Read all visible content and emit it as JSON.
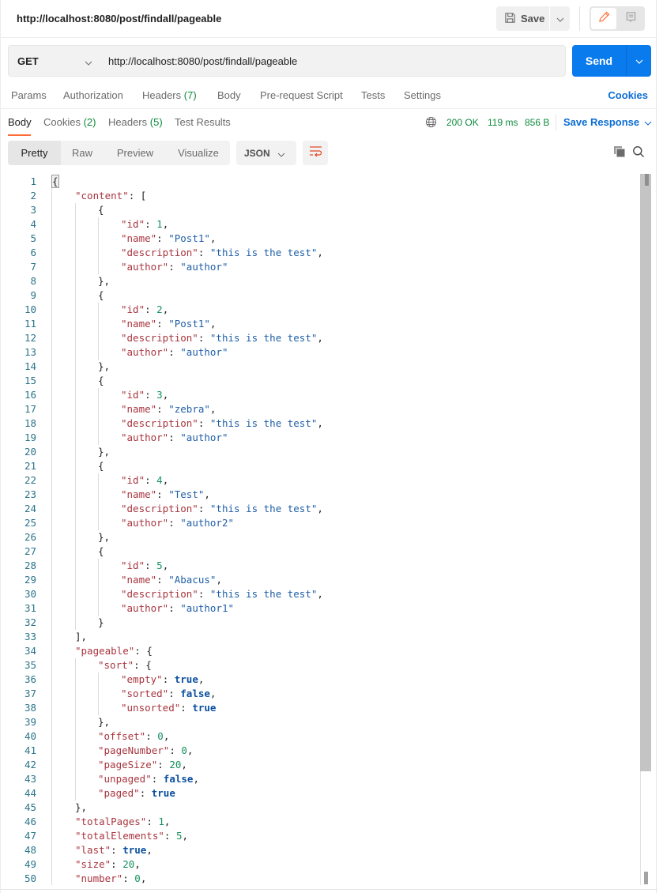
{
  "header": {
    "title": "http://localhost:8080/post/findall/pageable",
    "save_label": "Save"
  },
  "request": {
    "method": "GET",
    "url": "http://localhost:8080/post/findall/pageable",
    "send_label": "Send"
  },
  "request_tabs": {
    "params": "Params",
    "authorization": "Authorization",
    "headers": "Headers",
    "headers_count": "(7)",
    "body": "Body",
    "pre_request": "Pre-request Script",
    "tests": "Tests",
    "settings": "Settings",
    "cookies_link": "Cookies"
  },
  "response_tabs": {
    "body": "Body",
    "cookies": "Cookies",
    "cookies_count": "(2)",
    "headers": "Headers",
    "headers_count": "(5)",
    "test_results": "Test Results"
  },
  "response_status": {
    "status": "200 OK",
    "time": "119 ms",
    "size": "856 B",
    "save_response_label": "Save Response"
  },
  "view_modes": {
    "pretty": "Pretty",
    "raw": "Raw",
    "preview": "Preview",
    "visualize": "Visualize",
    "selected": "Pretty",
    "format": "JSON"
  },
  "colors": {
    "accent_orange": "#ff6c37",
    "send_blue": "#097bed",
    "link_blue": "#0b6cd4",
    "status_green": "#0e8a3c",
    "json_key": "#a8353f",
    "json_string": "#1f5fa8",
    "json_number": "#14925c",
    "json_boolean": "#0b4fa0"
  },
  "editor": {
    "lines": [
      {
        "n": "1",
        "indent": 0,
        "tokens": [
          [
            "p",
            "{"
          ]
        ],
        "cursor": true
      },
      {
        "n": "2",
        "indent": 1,
        "tokens": [
          [
            "k",
            "\"content\""
          ],
          [
            "p",
            ": ["
          ]
        ]
      },
      {
        "n": "3",
        "indent": 2,
        "tokens": [
          [
            "p",
            "{"
          ]
        ]
      },
      {
        "n": "4",
        "indent": 3,
        "tokens": [
          [
            "k",
            "\"id\""
          ],
          [
            "p",
            ": "
          ],
          [
            "n",
            "1"
          ],
          [
            "p",
            ","
          ]
        ]
      },
      {
        "n": "5",
        "indent": 3,
        "tokens": [
          [
            "k",
            "\"name\""
          ],
          [
            "p",
            ": "
          ],
          [
            "s",
            "\"Post1\""
          ],
          [
            "p",
            ","
          ]
        ]
      },
      {
        "n": "6",
        "indent": 3,
        "tokens": [
          [
            "k",
            "\"description\""
          ],
          [
            "p",
            ": "
          ],
          [
            "s",
            "\"this is the test\""
          ],
          [
            "p",
            ","
          ]
        ]
      },
      {
        "n": "7",
        "indent": 3,
        "tokens": [
          [
            "k",
            "\"author\""
          ],
          [
            "p",
            ": "
          ],
          [
            "s",
            "\"author\""
          ]
        ]
      },
      {
        "n": "8",
        "indent": 2,
        "tokens": [
          [
            "p",
            "},"
          ]
        ]
      },
      {
        "n": "9",
        "indent": 2,
        "tokens": [
          [
            "p",
            "{"
          ]
        ]
      },
      {
        "n": "10",
        "indent": 3,
        "tokens": [
          [
            "k",
            "\"id\""
          ],
          [
            "p",
            ": "
          ],
          [
            "n",
            "2"
          ],
          [
            "p",
            ","
          ]
        ]
      },
      {
        "n": "11",
        "indent": 3,
        "tokens": [
          [
            "k",
            "\"name\""
          ],
          [
            "p",
            ": "
          ],
          [
            "s",
            "\"Post1\""
          ],
          [
            "p",
            ","
          ]
        ]
      },
      {
        "n": "12",
        "indent": 3,
        "tokens": [
          [
            "k",
            "\"description\""
          ],
          [
            "p",
            ": "
          ],
          [
            "s",
            "\"this is the test\""
          ],
          [
            "p",
            ","
          ]
        ]
      },
      {
        "n": "13",
        "indent": 3,
        "tokens": [
          [
            "k",
            "\"author\""
          ],
          [
            "p",
            ": "
          ],
          [
            "s",
            "\"author\""
          ]
        ]
      },
      {
        "n": "14",
        "indent": 2,
        "tokens": [
          [
            "p",
            "},"
          ]
        ]
      },
      {
        "n": "15",
        "indent": 2,
        "tokens": [
          [
            "p",
            "{"
          ]
        ]
      },
      {
        "n": "16",
        "indent": 3,
        "tokens": [
          [
            "k",
            "\"id\""
          ],
          [
            "p",
            ": "
          ],
          [
            "n",
            "3"
          ],
          [
            "p",
            ","
          ]
        ]
      },
      {
        "n": "17",
        "indent": 3,
        "tokens": [
          [
            "k",
            "\"name\""
          ],
          [
            "p",
            ": "
          ],
          [
            "s",
            "\"zebra\""
          ],
          [
            "p",
            ","
          ]
        ]
      },
      {
        "n": "18",
        "indent": 3,
        "tokens": [
          [
            "k",
            "\"description\""
          ],
          [
            "p",
            ": "
          ],
          [
            "s",
            "\"this is the test\""
          ],
          [
            "p",
            ","
          ]
        ]
      },
      {
        "n": "19",
        "indent": 3,
        "tokens": [
          [
            "k",
            "\"author\""
          ],
          [
            "p",
            ": "
          ],
          [
            "s",
            "\"author\""
          ]
        ]
      },
      {
        "n": "20",
        "indent": 2,
        "tokens": [
          [
            "p",
            "},"
          ]
        ]
      },
      {
        "n": "21",
        "indent": 2,
        "tokens": [
          [
            "p",
            "{"
          ]
        ]
      },
      {
        "n": "22",
        "indent": 3,
        "tokens": [
          [
            "k",
            "\"id\""
          ],
          [
            "p",
            ": "
          ],
          [
            "n",
            "4"
          ],
          [
            "p",
            ","
          ]
        ]
      },
      {
        "n": "23",
        "indent": 3,
        "tokens": [
          [
            "k",
            "\"name\""
          ],
          [
            "p",
            ": "
          ],
          [
            "s",
            "\"Test\""
          ],
          [
            "p",
            ","
          ]
        ]
      },
      {
        "n": "24",
        "indent": 3,
        "tokens": [
          [
            "k",
            "\"description\""
          ],
          [
            "p",
            ": "
          ],
          [
            "s",
            "\"this is the test\""
          ],
          [
            "p",
            ","
          ]
        ]
      },
      {
        "n": "25",
        "indent": 3,
        "tokens": [
          [
            "k",
            "\"author\""
          ],
          [
            "p",
            ": "
          ],
          [
            "s",
            "\"author2\""
          ]
        ]
      },
      {
        "n": "26",
        "indent": 2,
        "tokens": [
          [
            "p",
            "},"
          ]
        ]
      },
      {
        "n": "27",
        "indent": 2,
        "tokens": [
          [
            "p",
            "{"
          ]
        ]
      },
      {
        "n": "28",
        "indent": 3,
        "tokens": [
          [
            "k",
            "\"id\""
          ],
          [
            "p",
            ": "
          ],
          [
            "n",
            "5"
          ],
          [
            "p",
            ","
          ]
        ]
      },
      {
        "n": "29",
        "indent": 3,
        "tokens": [
          [
            "k",
            "\"name\""
          ],
          [
            "p",
            ": "
          ],
          [
            "s",
            "\"Abacus\""
          ],
          [
            "p",
            ","
          ]
        ]
      },
      {
        "n": "30",
        "indent": 3,
        "tokens": [
          [
            "k",
            "\"description\""
          ],
          [
            "p",
            ": "
          ],
          [
            "s",
            "\"this is the test\""
          ],
          [
            "p",
            ","
          ]
        ]
      },
      {
        "n": "31",
        "indent": 3,
        "tokens": [
          [
            "k",
            "\"author\""
          ],
          [
            "p",
            ": "
          ],
          [
            "s",
            "\"author1\""
          ]
        ]
      },
      {
        "n": "32",
        "indent": 2,
        "tokens": [
          [
            "p",
            "}"
          ]
        ]
      },
      {
        "n": "33",
        "indent": 1,
        "tokens": [
          [
            "p",
            "],"
          ]
        ]
      },
      {
        "n": "34",
        "indent": 1,
        "tokens": [
          [
            "k",
            "\"pageable\""
          ],
          [
            "p",
            ": {"
          ]
        ]
      },
      {
        "n": "35",
        "indent": 2,
        "tokens": [
          [
            "k",
            "\"sort\""
          ],
          [
            "p",
            ": {"
          ]
        ]
      },
      {
        "n": "36",
        "indent": 3,
        "tokens": [
          [
            "k",
            "\"empty\""
          ],
          [
            "p",
            ": "
          ],
          [
            "b",
            "true"
          ],
          [
            "p",
            ","
          ]
        ]
      },
      {
        "n": "37",
        "indent": 3,
        "tokens": [
          [
            "k",
            "\"sorted\""
          ],
          [
            "p",
            ": "
          ],
          [
            "b",
            "false"
          ],
          [
            "p",
            ","
          ]
        ]
      },
      {
        "n": "38",
        "indent": 3,
        "tokens": [
          [
            "k",
            "\"unsorted\""
          ],
          [
            "p",
            ": "
          ],
          [
            "b",
            "true"
          ]
        ]
      },
      {
        "n": "39",
        "indent": 2,
        "tokens": [
          [
            "p",
            "},"
          ]
        ]
      },
      {
        "n": "40",
        "indent": 2,
        "tokens": [
          [
            "k",
            "\"offset\""
          ],
          [
            "p",
            ": "
          ],
          [
            "n",
            "0"
          ],
          [
            "p",
            ","
          ]
        ]
      },
      {
        "n": "41",
        "indent": 2,
        "tokens": [
          [
            "k",
            "\"pageNumber\""
          ],
          [
            "p",
            ": "
          ],
          [
            "n",
            "0"
          ],
          [
            "p",
            ","
          ]
        ]
      },
      {
        "n": "42",
        "indent": 2,
        "tokens": [
          [
            "k",
            "\"pageSize\""
          ],
          [
            "p",
            ": "
          ],
          [
            "n",
            "20"
          ],
          [
            "p",
            ","
          ]
        ]
      },
      {
        "n": "43",
        "indent": 2,
        "tokens": [
          [
            "k",
            "\"unpaged\""
          ],
          [
            "p",
            ": "
          ],
          [
            "b",
            "false"
          ],
          [
            "p",
            ","
          ]
        ]
      },
      {
        "n": "44",
        "indent": 2,
        "tokens": [
          [
            "k",
            "\"paged\""
          ],
          [
            "p",
            ": "
          ],
          [
            "b",
            "true"
          ]
        ]
      },
      {
        "n": "45",
        "indent": 1,
        "tokens": [
          [
            "p",
            "},"
          ]
        ]
      },
      {
        "n": "46",
        "indent": 1,
        "tokens": [
          [
            "k",
            "\"totalPages\""
          ],
          [
            "p",
            ": "
          ],
          [
            "n",
            "1"
          ],
          [
            "p",
            ","
          ]
        ]
      },
      {
        "n": "47",
        "indent": 1,
        "tokens": [
          [
            "k",
            "\"totalElements\""
          ],
          [
            "p",
            ": "
          ],
          [
            "n",
            "5"
          ],
          [
            "p",
            ","
          ]
        ]
      },
      {
        "n": "48",
        "indent": 1,
        "tokens": [
          [
            "k",
            "\"last\""
          ],
          [
            "p",
            ": "
          ],
          [
            "b",
            "true"
          ],
          [
            "p",
            ","
          ]
        ]
      },
      {
        "n": "49",
        "indent": 1,
        "tokens": [
          [
            "k",
            "\"size\""
          ],
          [
            "p",
            ": "
          ],
          [
            "n",
            "20"
          ],
          [
            "p",
            ","
          ]
        ]
      },
      {
        "n": "50",
        "indent": 1,
        "tokens": [
          [
            "k",
            "\"number\""
          ],
          [
            "p",
            ": "
          ],
          [
            "n",
            "0"
          ],
          [
            "p",
            ","
          ]
        ]
      }
    ],
    "scroll_position_fraction": 0.0,
    "visible_fraction": 0.84
  }
}
